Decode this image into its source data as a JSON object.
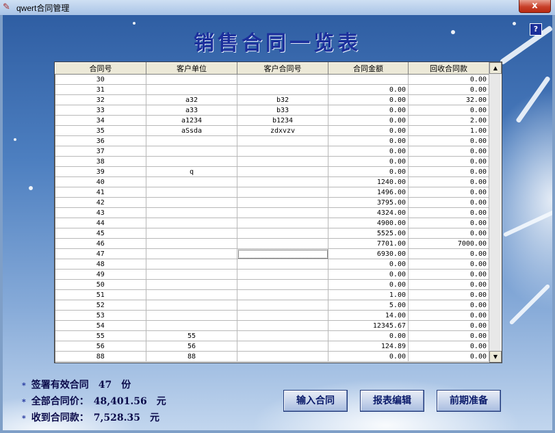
{
  "window": {
    "title": "qwert合同管理",
    "close_label": "x",
    "app_icon": "pencil-icon"
  },
  "header": {
    "title": "销售合同一览表",
    "help_label": "?"
  },
  "table": {
    "columns": [
      "合同号",
      "客户单位",
      "客户合同号",
      "合同金额",
      "回收合同款"
    ],
    "rows": [
      [
        "30",
        "",
        "",
        "",
        "0.00"
      ],
      [
        "31",
        "",
        "",
        "0.00",
        "0.00"
      ],
      [
        "32",
        "a32",
        "b32",
        "0.00",
        "32.00"
      ],
      [
        "33",
        "a33",
        "b33",
        "0.00",
        "0.00"
      ],
      [
        "34",
        "a1234",
        "b1234",
        "0.00",
        "2.00"
      ],
      [
        "35",
        "aSsda",
        "zdxvzv",
        "0.00",
        "1.00"
      ],
      [
        "36",
        "",
        "",
        "0.00",
        "0.00"
      ],
      [
        "37",
        "",
        "",
        "0.00",
        "0.00"
      ],
      [
        "38",
        "",
        "",
        "0.00",
        "0.00"
      ],
      [
        "39",
        "q",
        "",
        "0.00",
        "0.00"
      ],
      [
        "40",
        "",
        "",
        "1240.00",
        "0.00"
      ],
      [
        "41",
        "",
        "",
        "1496.00",
        "0.00"
      ],
      [
        "42",
        "",
        "",
        "3795.00",
        "0.00"
      ],
      [
        "43",
        "",
        "",
        "4324.00",
        "0.00"
      ],
      [
        "44",
        "",
        "",
        "4900.00",
        "0.00"
      ],
      [
        "45",
        "",
        "",
        "5525.00",
        "0.00"
      ],
      [
        "46",
        "",
        "",
        "7701.00",
        "7000.00"
      ],
      [
        "47",
        "",
        "",
        "6930.00",
        "0.00"
      ],
      [
        "48",
        "",
        "",
        "0.00",
        "0.00"
      ],
      [
        "49",
        "",
        "",
        "0.00",
        "0.00"
      ],
      [
        "50",
        "",
        "",
        "0.00",
        "0.00"
      ],
      [
        "51",
        "",
        "",
        "1.00",
        "0.00"
      ],
      [
        "52",
        "",
        "",
        "5.00",
        "0.00"
      ],
      [
        "53",
        "",
        "",
        "14.00",
        "0.00"
      ],
      [
        "54",
        "",
        "",
        "12345.67",
        "0.00"
      ],
      [
        "55",
        "55",
        "",
        "0.00",
        "0.00"
      ],
      [
        "56",
        "56",
        "",
        "124.89",
        "0.00"
      ],
      [
        "88",
        "88",
        "",
        "0.00",
        "0.00"
      ]
    ]
  },
  "summary": {
    "bullet": "*",
    "signed": "签署有效合同　47　份",
    "total": "全部合同价：　48,401.56　元",
    "received": "收到合同款：　7,528.35　元"
  },
  "buttons": {
    "input": "输入合同",
    "edit": "报表编辑",
    "prepare": "前期准备"
  }
}
